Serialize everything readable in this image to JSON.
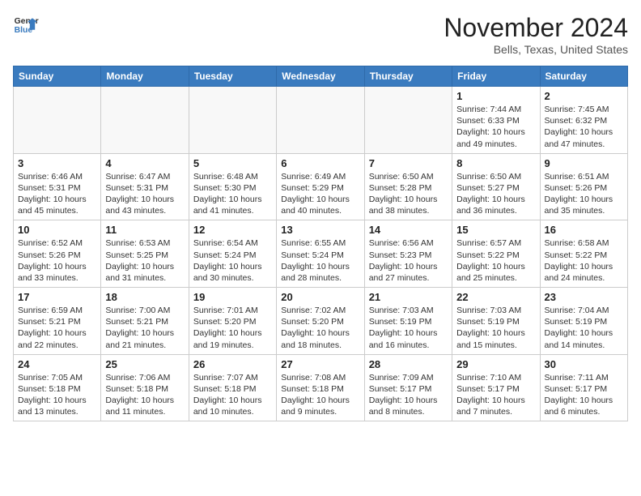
{
  "header": {
    "logo_line1": "General",
    "logo_line2": "Blue",
    "month": "November 2024",
    "location": "Bells, Texas, United States"
  },
  "weekdays": [
    "Sunday",
    "Monday",
    "Tuesday",
    "Wednesday",
    "Thursday",
    "Friday",
    "Saturday"
  ],
  "weeks": [
    [
      {
        "day": "",
        "info": ""
      },
      {
        "day": "",
        "info": ""
      },
      {
        "day": "",
        "info": ""
      },
      {
        "day": "",
        "info": ""
      },
      {
        "day": "",
        "info": ""
      },
      {
        "day": "1",
        "info": "Sunrise: 7:44 AM\nSunset: 6:33 PM\nDaylight: 10 hours and 49 minutes."
      },
      {
        "day": "2",
        "info": "Sunrise: 7:45 AM\nSunset: 6:32 PM\nDaylight: 10 hours and 47 minutes."
      }
    ],
    [
      {
        "day": "3",
        "info": "Sunrise: 6:46 AM\nSunset: 5:31 PM\nDaylight: 10 hours and 45 minutes."
      },
      {
        "day": "4",
        "info": "Sunrise: 6:47 AM\nSunset: 5:31 PM\nDaylight: 10 hours and 43 minutes."
      },
      {
        "day": "5",
        "info": "Sunrise: 6:48 AM\nSunset: 5:30 PM\nDaylight: 10 hours and 41 minutes."
      },
      {
        "day": "6",
        "info": "Sunrise: 6:49 AM\nSunset: 5:29 PM\nDaylight: 10 hours and 40 minutes."
      },
      {
        "day": "7",
        "info": "Sunrise: 6:50 AM\nSunset: 5:28 PM\nDaylight: 10 hours and 38 minutes."
      },
      {
        "day": "8",
        "info": "Sunrise: 6:50 AM\nSunset: 5:27 PM\nDaylight: 10 hours and 36 minutes."
      },
      {
        "day": "9",
        "info": "Sunrise: 6:51 AM\nSunset: 5:26 PM\nDaylight: 10 hours and 35 minutes."
      }
    ],
    [
      {
        "day": "10",
        "info": "Sunrise: 6:52 AM\nSunset: 5:26 PM\nDaylight: 10 hours and 33 minutes."
      },
      {
        "day": "11",
        "info": "Sunrise: 6:53 AM\nSunset: 5:25 PM\nDaylight: 10 hours and 31 minutes."
      },
      {
        "day": "12",
        "info": "Sunrise: 6:54 AM\nSunset: 5:24 PM\nDaylight: 10 hours and 30 minutes."
      },
      {
        "day": "13",
        "info": "Sunrise: 6:55 AM\nSunset: 5:24 PM\nDaylight: 10 hours and 28 minutes."
      },
      {
        "day": "14",
        "info": "Sunrise: 6:56 AM\nSunset: 5:23 PM\nDaylight: 10 hours and 27 minutes."
      },
      {
        "day": "15",
        "info": "Sunrise: 6:57 AM\nSunset: 5:22 PM\nDaylight: 10 hours and 25 minutes."
      },
      {
        "day": "16",
        "info": "Sunrise: 6:58 AM\nSunset: 5:22 PM\nDaylight: 10 hours and 24 minutes."
      }
    ],
    [
      {
        "day": "17",
        "info": "Sunrise: 6:59 AM\nSunset: 5:21 PM\nDaylight: 10 hours and 22 minutes."
      },
      {
        "day": "18",
        "info": "Sunrise: 7:00 AM\nSunset: 5:21 PM\nDaylight: 10 hours and 21 minutes."
      },
      {
        "day": "19",
        "info": "Sunrise: 7:01 AM\nSunset: 5:20 PM\nDaylight: 10 hours and 19 minutes."
      },
      {
        "day": "20",
        "info": "Sunrise: 7:02 AM\nSunset: 5:20 PM\nDaylight: 10 hours and 18 minutes."
      },
      {
        "day": "21",
        "info": "Sunrise: 7:03 AM\nSunset: 5:19 PM\nDaylight: 10 hours and 16 minutes."
      },
      {
        "day": "22",
        "info": "Sunrise: 7:03 AM\nSunset: 5:19 PM\nDaylight: 10 hours and 15 minutes."
      },
      {
        "day": "23",
        "info": "Sunrise: 7:04 AM\nSunset: 5:19 PM\nDaylight: 10 hours and 14 minutes."
      }
    ],
    [
      {
        "day": "24",
        "info": "Sunrise: 7:05 AM\nSunset: 5:18 PM\nDaylight: 10 hours and 13 minutes."
      },
      {
        "day": "25",
        "info": "Sunrise: 7:06 AM\nSunset: 5:18 PM\nDaylight: 10 hours and 11 minutes."
      },
      {
        "day": "26",
        "info": "Sunrise: 7:07 AM\nSunset: 5:18 PM\nDaylight: 10 hours and 10 minutes."
      },
      {
        "day": "27",
        "info": "Sunrise: 7:08 AM\nSunset: 5:18 PM\nDaylight: 10 hours and 9 minutes."
      },
      {
        "day": "28",
        "info": "Sunrise: 7:09 AM\nSunset: 5:17 PM\nDaylight: 10 hours and 8 minutes."
      },
      {
        "day": "29",
        "info": "Sunrise: 7:10 AM\nSunset: 5:17 PM\nDaylight: 10 hours and 7 minutes."
      },
      {
        "day": "30",
        "info": "Sunrise: 7:11 AM\nSunset: 5:17 PM\nDaylight: 10 hours and 6 minutes."
      }
    ]
  ]
}
